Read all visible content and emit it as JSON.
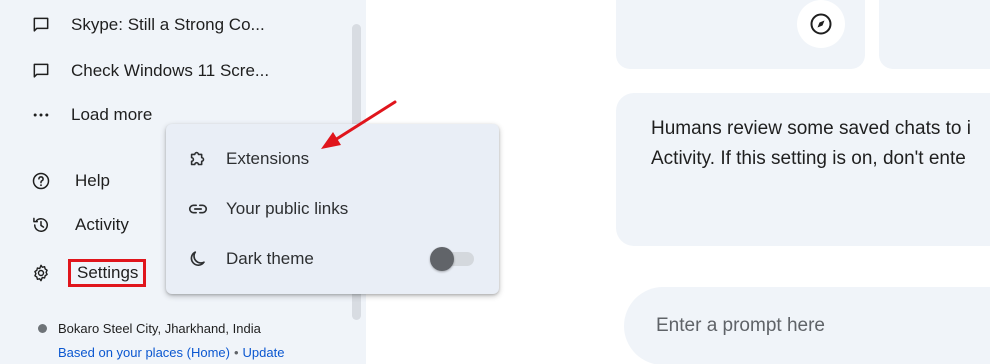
{
  "sidebar": {
    "recent_chats": [
      {
        "label": "Skype: Still a Strong Co...",
        "icon": "chat-bubble-icon"
      },
      {
        "label": "Check Windows 11 Scre...",
        "icon": "chat-bubble-icon"
      }
    ],
    "load_more": {
      "label": "Load more",
      "icon": "more-horiz-icon"
    },
    "items": [
      {
        "label": "Help",
        "icon": "help-icon"
      },
      {
        "label": "Activity",
        "icon": "history-icon"
      },
      {
        "label": "Settings",
        "icon": "gear-icon"
      }
    ],
    "location": {
      "place": "Bokaro Steel City, Jharkhand, India",
      "source_link": "Based on your places (Home)",
      "separator": "•",
      "update_link": "Update"
    }
  },
  "main": {
    "info_text_line1": "Humans review some saved chats to i",
    "info_text_line2": "Activity. If this setting is on, don't ente",
    "prompt_placeholder": "Enter a prompt here"
  },
  "settings_menu": {
    "items": [
      {
        "label": "Extensions",
        "icon": "puzzle-icon"
      },
      {
        "label": "Your public links",
        "icon": "link-icon"
      },
      {
        "label": "Dark theme",
        "icon": "moon-icon",
        "toggle": "off"
      }
    ]
  },
  "colors": {
    "sidebar_bg": "#f0f4f9",
    "menu_bg": "#e9eef6",
    "highlight_red": "#e0151c",
    "link_blue": "#0b57d0"
  }
}
